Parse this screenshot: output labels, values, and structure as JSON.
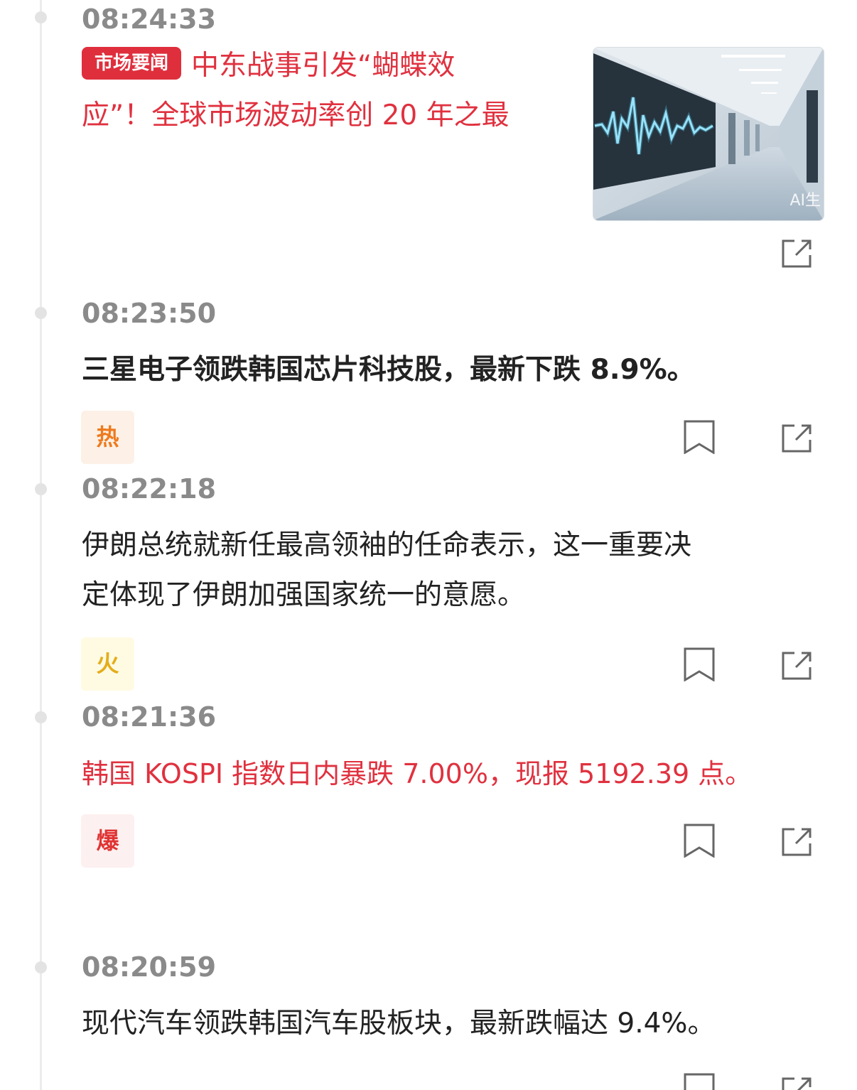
{
  "feed": [
    {
      "time": "08:24:33",
      "tag": "市场要闻",
      "headline_line1": "中东战事引发“蝴蝶效",
      "headline_line2": "应”！全球市场波动率创 20 年之最",
      "thumbnail_caption": "AI生",
      "style": "red",
      "share_icon": "share-icon"
    },
    {
      "time": "08:23:50",
      "headline": "三星电子领跌韩国芯片科技股，最新下跌 8.9%。",
      "badge": "热",
      "style": "bold",
      "bookmark_icon": "bookmark-icon",
      "share_icon": "share-icon"
    },
    {
      "time": "08:22:18",
      "headline_line1": "伊朗总统就新任最高领袖的任命表示，这一重要决",
      "headline_line2": "定体现了伊朗加强国家统一的意愿。",
      "badge": "火",
      "style": "normal",
      "bookmark_icon": "bookmark-icon",
      "share_icon": "share-icon"
    },
    {
      "time": "08:21:36",
      "headline": "韩国 KOSPI 指数日内暴跌 7.00%，现报 5192.39 点。",
      "badge": "爆",
      "style": "red",
      "bookmark_icon": "bookmark-icon",
      "share_icon": "share-icon"
    },
    {
      "time": "08:20:59",
      "headline": "现代汽车领跌韩国汽车股板块，最新跌幅达 9.4%。",
      "style": "normal",
      "bookmark_icon": "bookmark-icon",
      "share_icon": "share-icon"
    }
  ],
  "colors": {
    "accent_red": "#e0313f",
    "time_gray": "#8a8a8a",
    "text_dark": "#222222",
    "badge_hot": "#ee7a1e",
    "badge_fire": "#e4ad1a",
    "badge_boom": "#e03434"
  }
}
